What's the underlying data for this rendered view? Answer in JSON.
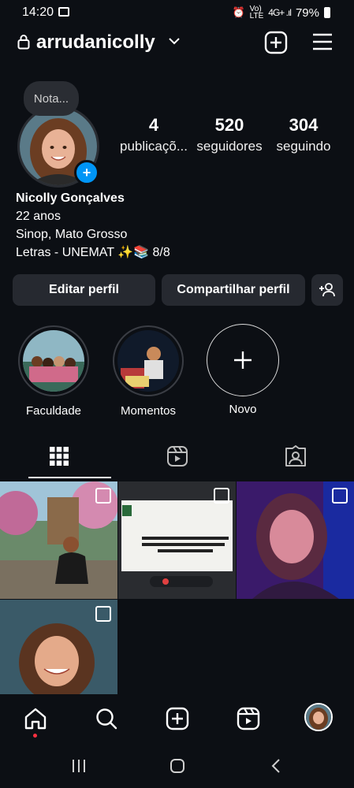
{
  "status_bar": {
    "time": "14:20",
    "battery": "79%"
  },
  "header": {
    "username": "arrudanicolly"
  },
  "note": {
    "text": "Nota..."
  },
  "stats": [
    {
      "value": "4",
      "label": "publicaçõ..."
    },
    {
      "value": "520",
      "label": "seguidores"
    },
    {
      "value": "304",
      "label": "seguindo"
    }
  ],
  "bio": {
    "name": "Nicolly Gonçalves",
    "line1": "22 anos",
    "line2": "Sinop, Mato Grosso",
    "line3": "Letras  - UNEMAT ✨📚 8/8"
  },
  "buttons": {
    "edit": "Editar perfil",
    "share": "Compartilhar perfil"
  },
  "highlights": [
    {
      "label": "Faculdade"
    },
    {
      "label": "Momentos"
    },
    {
      "label": "Novo"
    }
  ],
  "icons": {
    "lock": "lock-icon",
    "chevron": "chevron-down-icon",
    "add": "add-square-icon",
    "menu": "menu-icon",
    "grid": "grid-icon",
    "reels": "reels-icon",
    "tagged": "tagged-icon",
    "home": "home-icon",
    "search": "search-icon",
    "create": "create-icon"
  },
  "colors": {
    "background": "#0c0f14",
    "button": "#262930",
    "accent": "#0095f6",
    "notification": "#ff3040"
  }
}
